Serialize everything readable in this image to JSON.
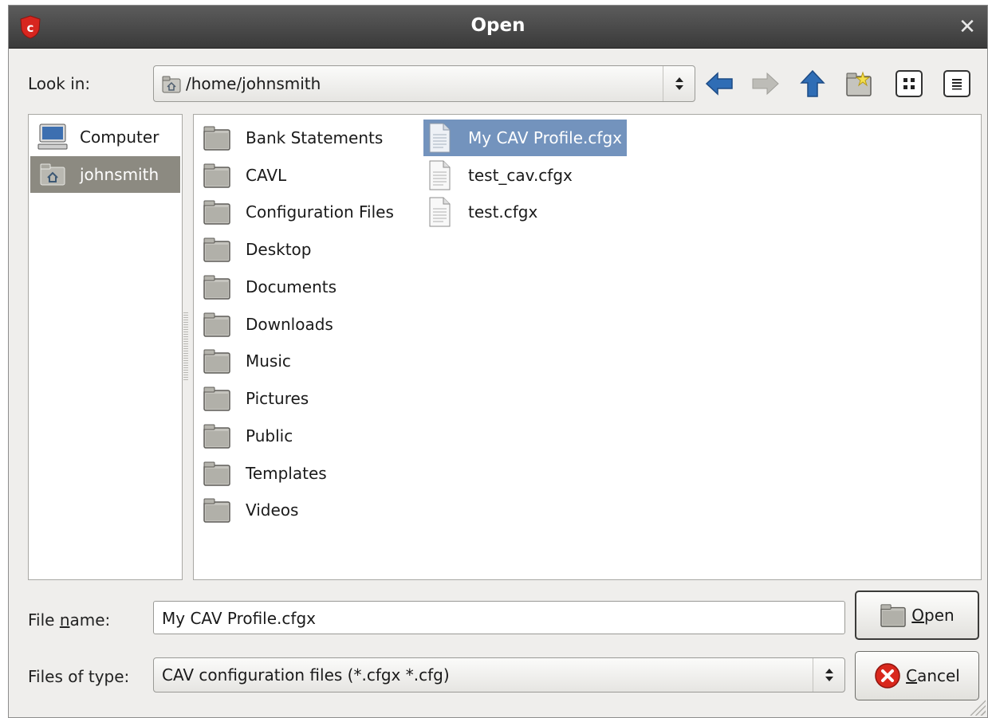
{
  "window": {
    "title": "Open"
  },
  "look_in": {
    "label": "Look in:",
    "path": "/home/johnsmith"
  },
  "toolbar": {
    "icons": [
      "back-arrow-icon",
      "forward-arrow-icon",
      "up-arrow-icon",
      "new-folder-icon",
      "icon-view-icon",
      "list-view-icon"
    ]
  },
  "places": [
    {
      "label": "Computer",
      "icon": "computer-icon",
      "selected": false
    },
    {
      "label": "johnsmith",
      "icon": "home-folder-icon",
      "selected": true
    }
  ],
  "files": {
    "folders": [
      "Bank Statements",
      "CAVL",
      "Configuration Files",
      "Desktop",
      "Documents",
      "Downloads",
      "Music",
      "Pictures",
      "Public",
      "Templates",
      "Videos"
    ],
    "documents": [
      "My CAV Profile.cfgx",
      "test_cav.cfgx",
      "test.cfgx"
    ],
    "selected": "My CAV Profile.cfgx"
  },
  "file_name": {
    "label_pre": "File ",
    "label_mnemonic": "n",
    "label_post": "ame:",
    "value": "My CAV Profile.cfgx"
  },
  "file_type": {
    "label": "Files of type:",
    "value": "CAV configuration files (*.cfgx *.cfg)"
  },
  "buttons": {
    "open_mnemonic": "O",
    "open_rest": "pen",
    "cancel_mnemonic": "C",
    "cancel_rest": "ancel"
  },
  "colors": {
    "selection": "#7393bd",
    "place_selection": "#8c8a81",
    "title_bar": "#4a4a4a",
    "arrow_blue": "#2f6db5"
  }
}
